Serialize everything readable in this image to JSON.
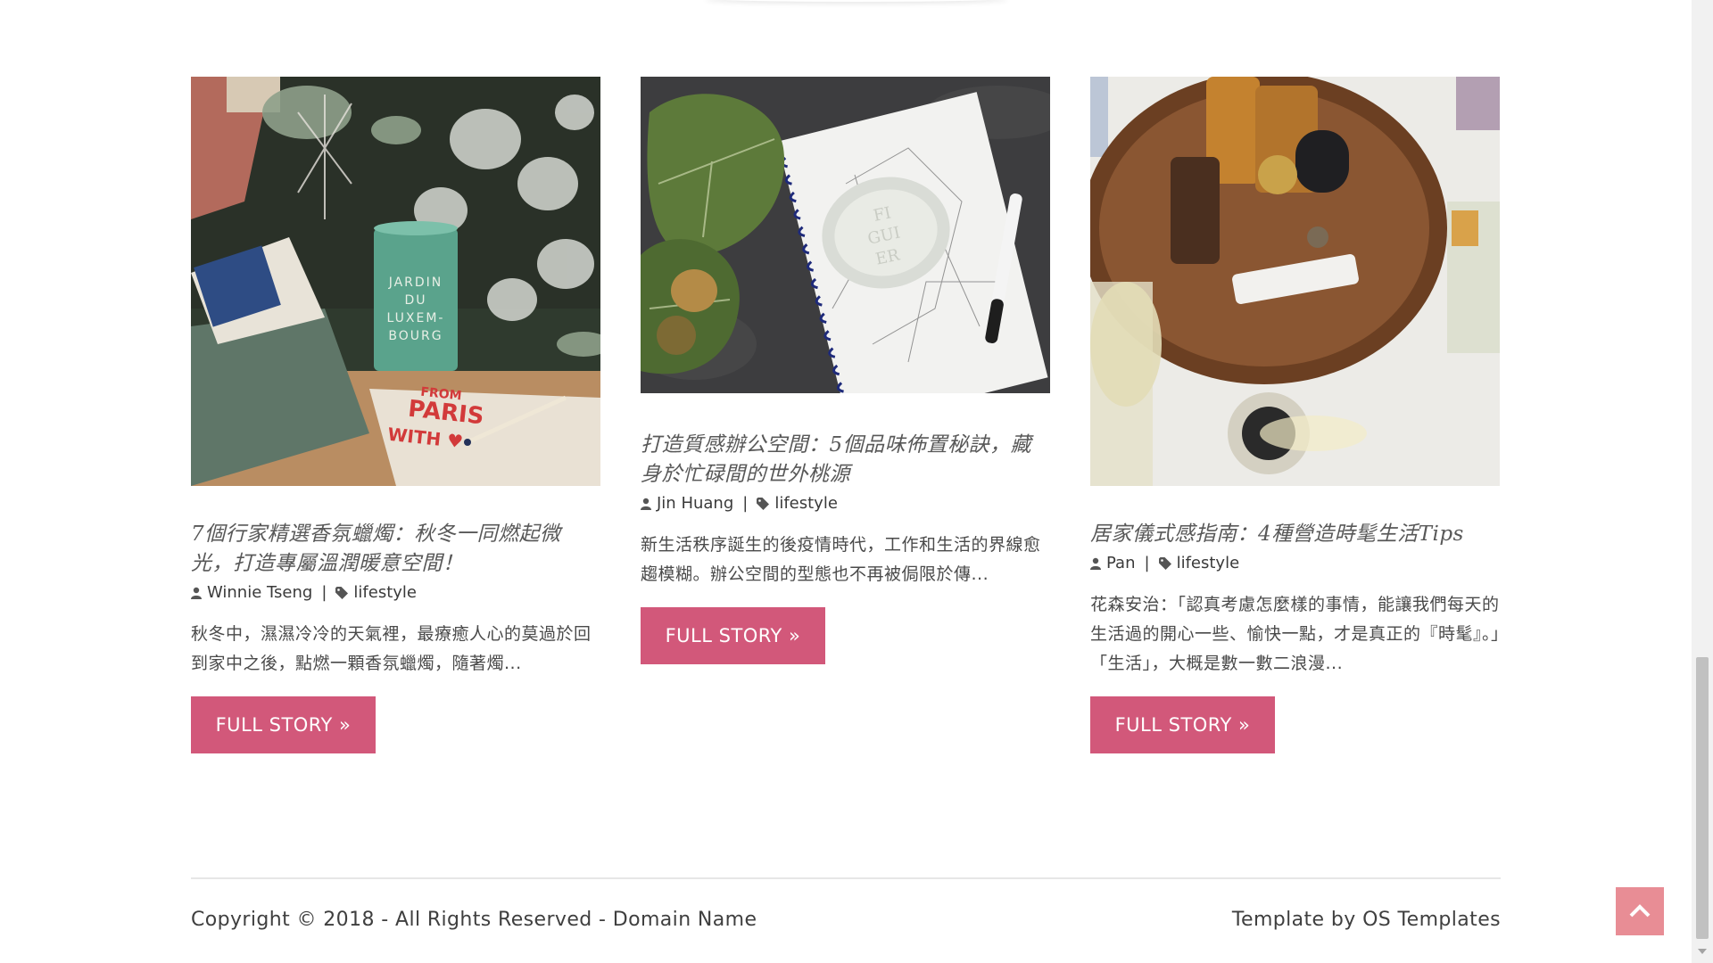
{
  "posts": [
    {
      "title": "7個行家精選香氛蠟燭：秋冬一同燃起微光，打造專屬溫潤暖意空間！",
      "author": "Winnie Tseng",
      "category": "lifestyle",
      "excerpt": "秋冬中，濕濕冷冷的天氣裡，最療癒人心的莫過於回到家中之後，點燃一顆香氛蠟燭，隨著燭...",
      "button_label": "FULL STORY »",
      "image_text": {
        "candle_label": "JARDIN DU LUXEM-BOURG",
        "card_text": "FROM PARIS WITH ♥"
      }
    },
    {
      "title": "打造質感辦公空間：5個品味佈置秘訣，藏身於忙碌間的世外桃源",
      "author": "Jin Huang",
      "category": "lifestyle",
      "excerpt": "新生活秩序誕生的後疫情時代，工作和生活的界線愈趨模糊。辦公空間的型態也不再被侷限於傳...",
      "button_label": "FULL STORY »",
      "image_text": {
        "candle_label": "FIGUIER"
      }
    },
    {
      "title": "居家儀式感指南：4種營造時髦生活Tips",
      "author": "Pan",
      "category": "lifestyle",
      "excerpt": "花森安治：「認真考慮怎麼樣的事情，能讓我們每天的生活過的開心一些、愉快一點，才是真正的『時髦』。」「生活」，大概是數一數二浪漫...",
      "button_label": "FULL STORY »"
    }
  ],
  "footer": {
    "copyright": "Copyright © 2018 - All Rights Reserved - Domain Name",
    "credit": "Template by OS Templates"
  },
  "icons": {
    "author": "user-icon",
    "category": "tag-icon",
    "back_to_top": "chevron-up-icon"
  },
  "colors": {
    "button": "#d2587a",
    "back_to_top": "#e88d95",
    "footer_rule": "#e6e6e6"
  }
}
